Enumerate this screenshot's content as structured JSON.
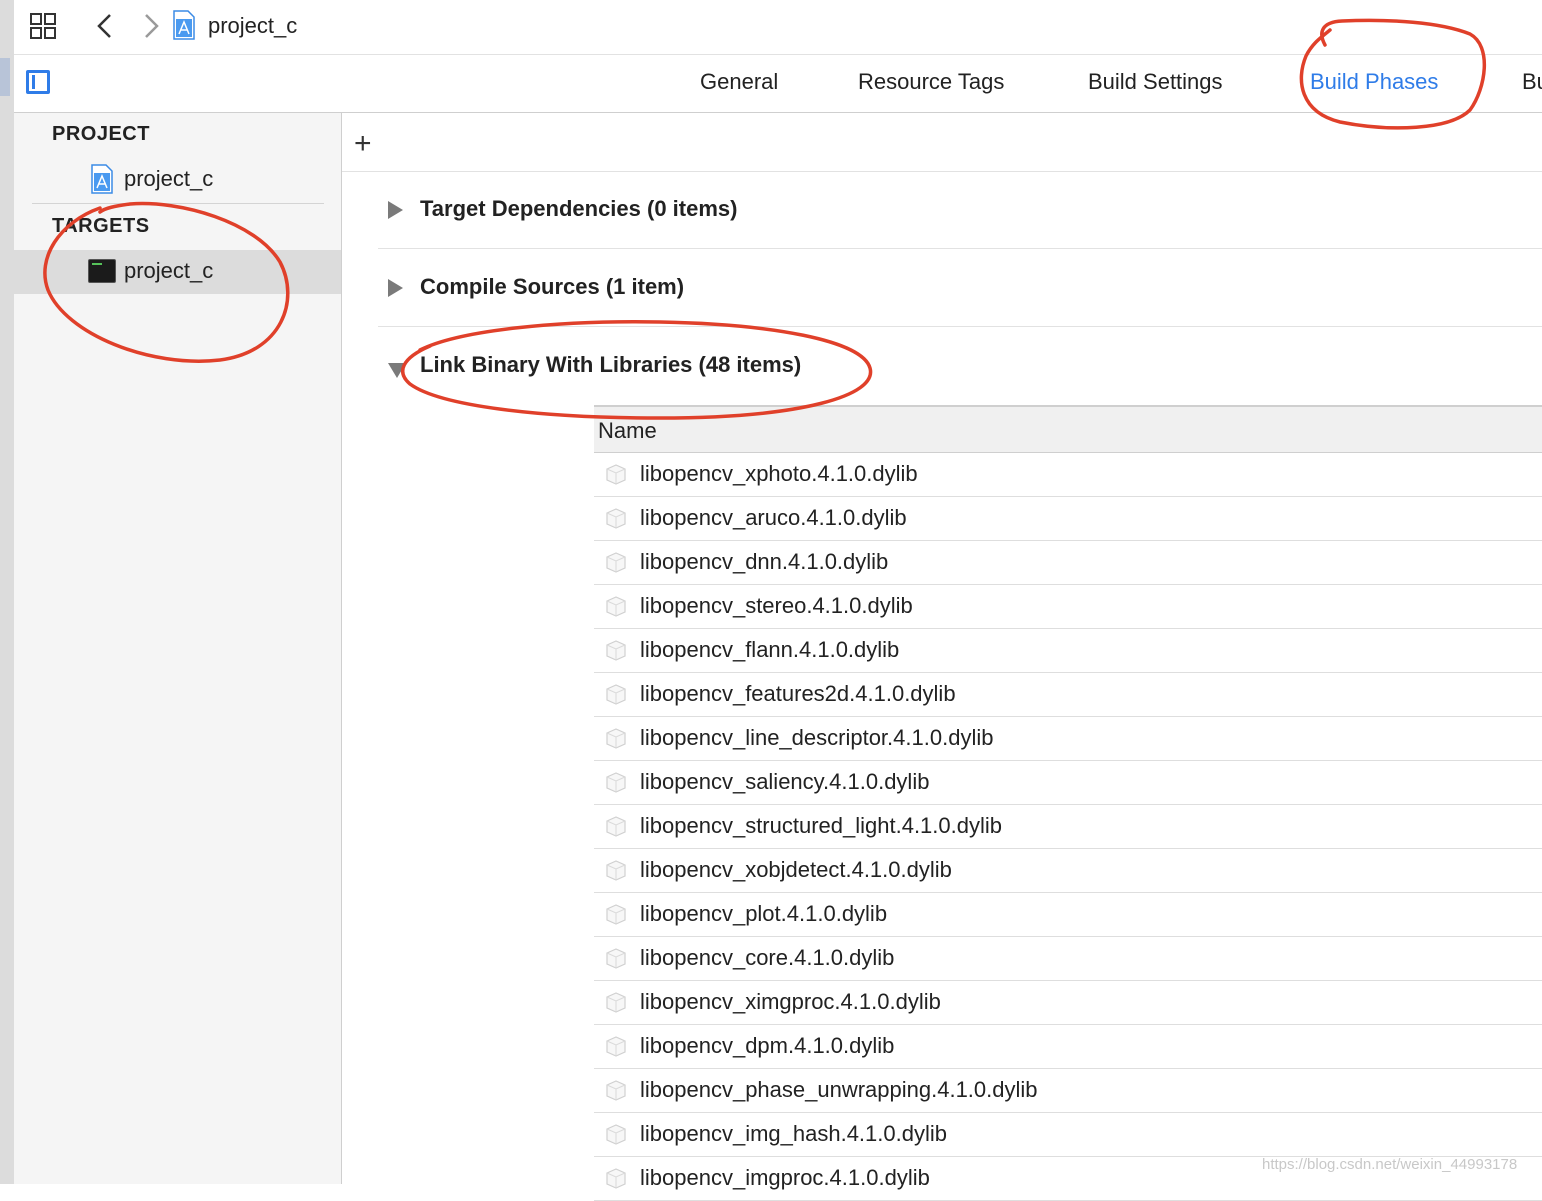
{
  "toolbar": {
    "project_title": "project_c"
  },
  "tabs": [
    {
      "label": "General",
      "active": false
    },
    {
      "label": "Resource Tags",
      "active": false
    },
    {
      "label": "Build Settings",
      "active": false
    },
    {
      "label": "Build Phases",
      "active": true
    },
    {
      "label": "Bu",
      "active": false
    }
  ],
  "sidebar": {
    "project_header": "PROJECT",
    "project_item": "project_c",
    "targets_header": "TARGETS",
    "target_item": "project_c"
  },
  "phases": [
    {
      "title": "Target Dependencies (0 items)",
      "expanded": false
    },
    {
      "title": "Compile Sources (1 item)",
      "expanded": false
    },
    {
      "title": "Link Binary With Libraries (48 items)",
      "expanded": true
    }
  ],
  "libraries": {
    "column_header": "Name",
    "items": [
      "libopencv_xphoto.4.1.0.dylib",
      "libopencv_aruco.4.1.0.dylib",
      "libopencv_dnn.4.1.0.dylib",
      "libopencv_stereo.4.1.0.dylib",
      "libopencv_flann.4.1.0.dylib",
      "libopencv_features2d.4.1.0.dylib",
      "libopencv_line_descriptor.4.1.0.dylib",
      "libopencv_saliency.4.1.0.dylib",
      "libopencv_structured_light.4.1.0.dylib",
      "libopencv_xobjdetect.4.1.0.dylib",
      "libopencv_plot.4.1.0.dylib",
      "libopencv_core.4.1.0.dylib",
      "libopencv_ximgproc.4.1.0.dylib",
      "libopencv_dpm.4.1.0.dylib",
      "libopencv_phase_unwrapping.4.1.0.dylib",
      "libopencv_img_hash.4.1.0.dylib",
      "libopencv_imgproc.4.1.0.dylib"
    ]
  },
  "watermark": "https://blog.csdn.net/weixin_44993178",
  "colors": {
    "accent": "#2f7ce8",
    "annotation": "#e0402a"
  }
}
